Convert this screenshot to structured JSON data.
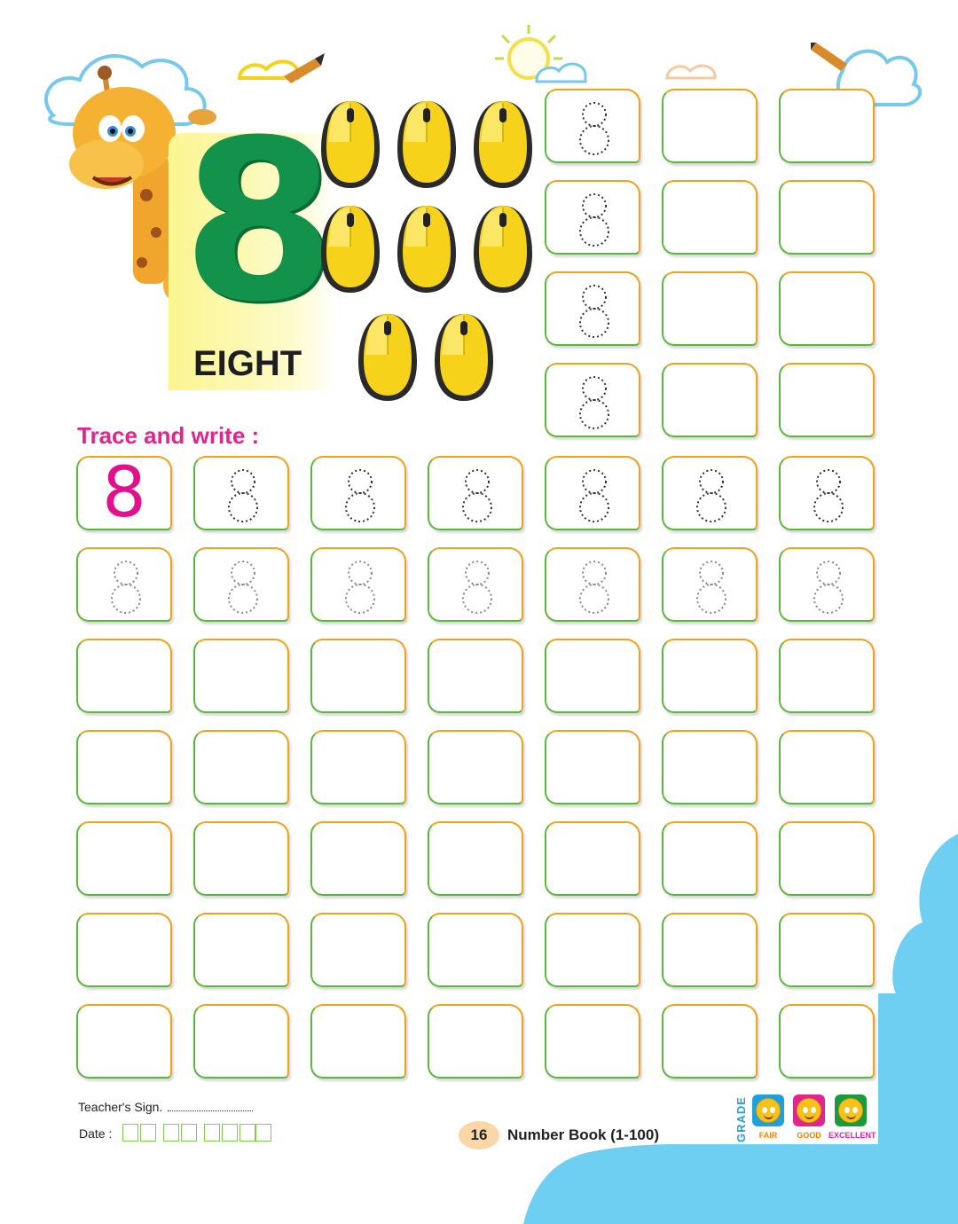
{
  "header": {
    "digit": "8",
    "word": "EIGHT",
    "object_icon": "computer-mouse-icon",
    "object_count": 8
  },
  "instruction": "Trace and write :",
  "grid": {
    "model_digit": "8",
    "trace_digit": "8"
  },
  "footer": {
    "teacher_sign_label": "Teacher's Sign.",
    "date_label": "Date :",
    "page_number": "16",
    "book_title": "Number Book (1-100)"
  },
  "grade": {
    "label": "GRADE",
    "levels": [
      {
        "label": "FAIR",
        "color": "#1ea0dc"
      },
      {
        "label": "GOOD",
        "color": "#e0258f"
      },
      {
        "label": "EXCELLENT",
        "color": "#1a9a3c"
      }
    ]
  },
  "colors": {
    "accent_pink": "#e0258f",
    "digit_green": "#12924a",
    "mouse_yellow": "#f6d21a",
    "box_green": "#5cb83a",
    "box_orange": "#f0a21c",
    "cloud_blue": "#6ecff2"
  }
}
